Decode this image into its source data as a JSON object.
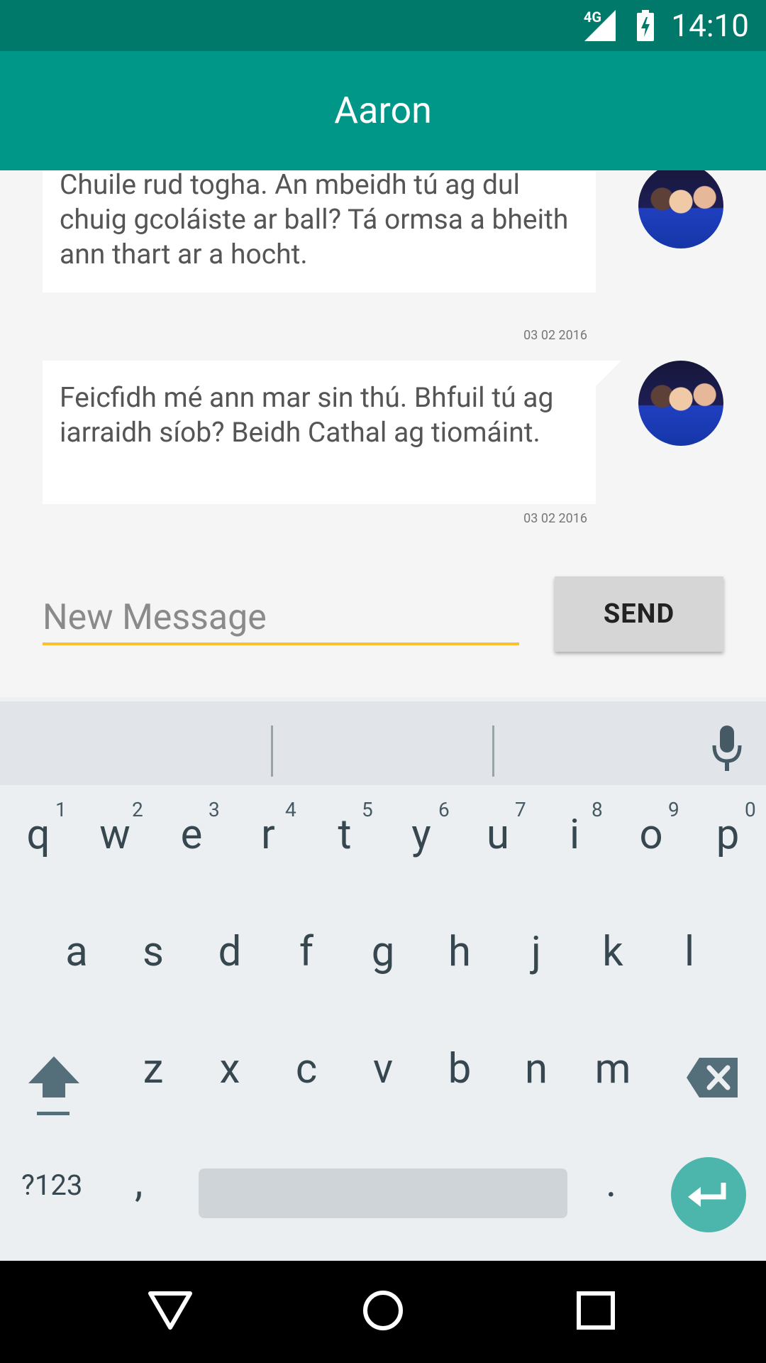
{
  "status_bar": {
    "time": "14:10",
    "network": "4G",
    "icons": [
      "signal-icon",
      "battery-charging-icon"
    ]
  },
  "app_bar": {
    "title": "Aaron"
  },
  "messages": [
    {
      "text": "Chuile rud togha. An mbeidh tú ag dul chuig gcoláiste ar ball? Tá ormsa a bheith ann thart ar a hocht.",
      "date": "03 02 2016"
    },
    {
      "text": "Feicfidh mé ann mar sin thú. Bhfuil tú ag iarraidh síob? Beidh Cathal ag tiomáint.",
      "date": "03 02 2016"
    }
  ],
  "composer": {
    "placeholder": "New Message",
    "value": "",
    "send_label": "SEND",
    "accent_color": "#fbc02d"
  },
  "keyboard": {
    "row1": [
      "q",
      "w",
      "e",
      "r",
      "t",
      "y",
      "u",
      "i",
      "o",
      "p"
    ],
    "row1_hints": [
      "1",
      "2",
      "3",
      "4",
      "5",
      "6",
      "7",
      "8",
      "9",
      "0"
    ],
    "row2": [
      "a",
      "s",
      "d",
      "f",
      "g",
      "h",
      "j",
      "k",
      "l"
    ],
    "row3": [
      "z",
      "x",
      "c",
      "v",
      "b",
      "n",
      "m"
    ],
    "symbols_label": "?123",
    "comma": ",",
    "period": "."
  },
  "colors": {
    "status_bar": "#00796b",
    "app_bar": "#009688",
    "enter_key": "#4db6ac"
  }
}
